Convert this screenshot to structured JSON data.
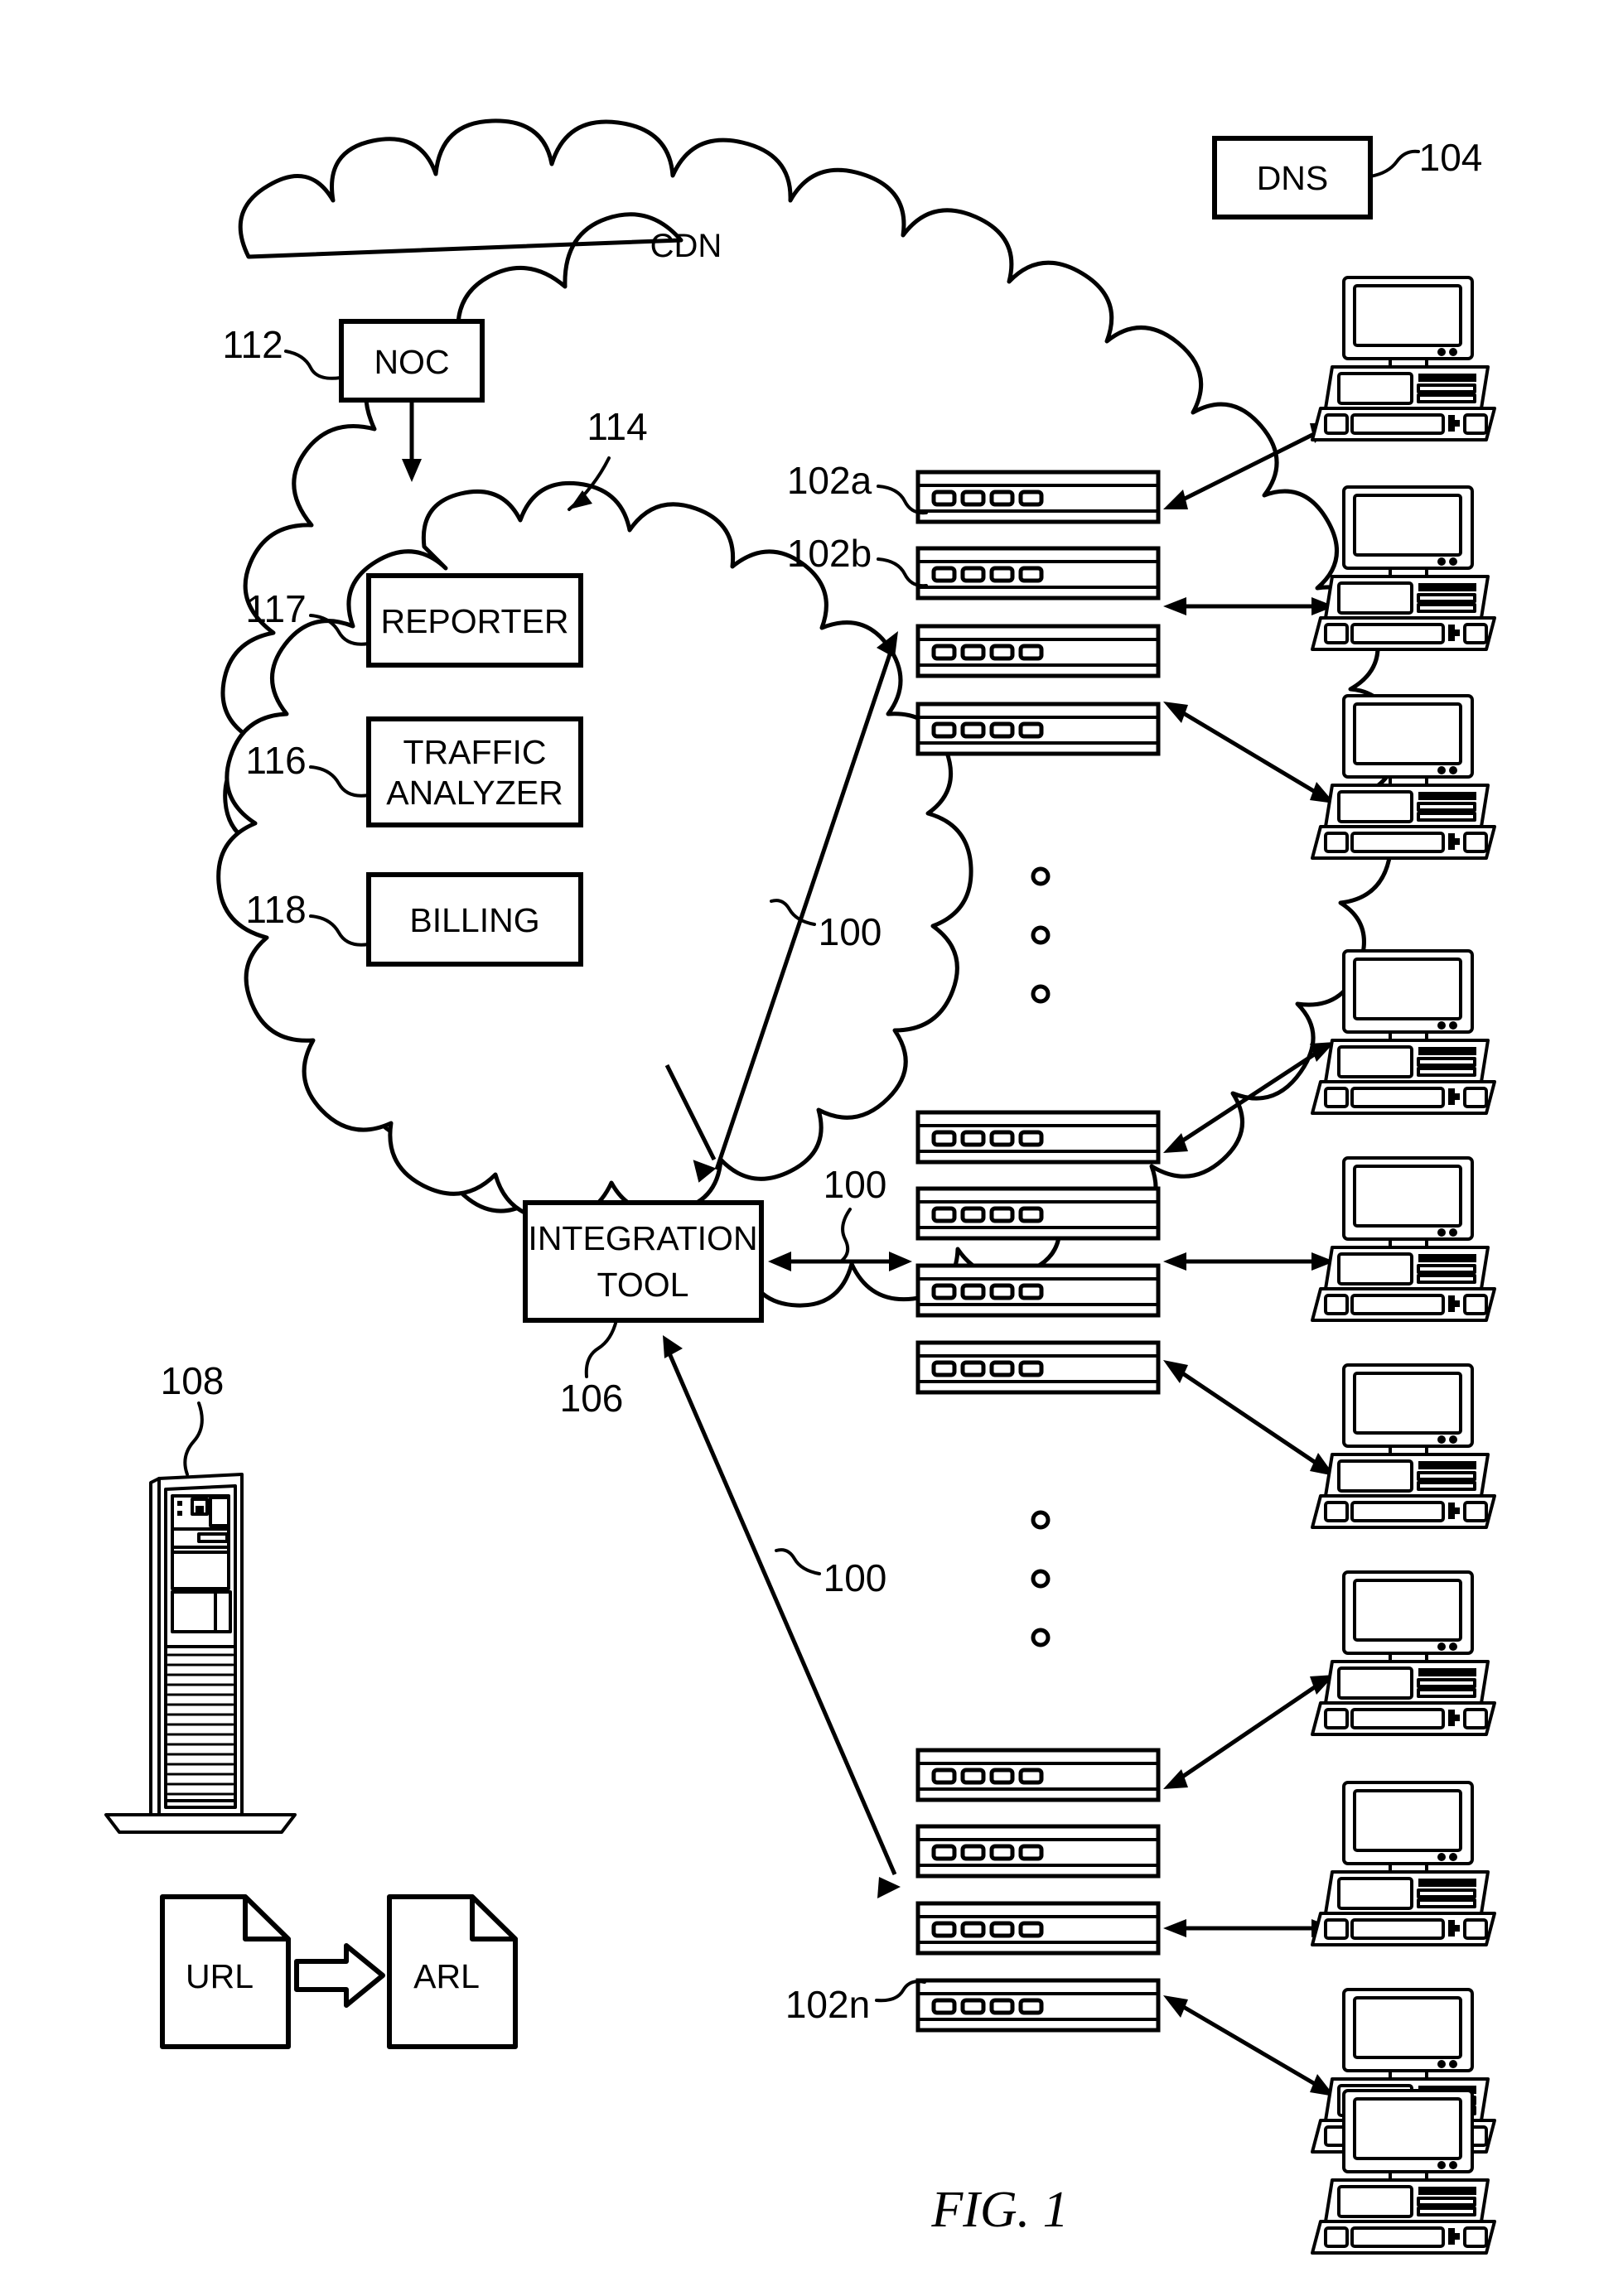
{
  "figure": {
    "caption": "FIG. 1",
    "cdn_label": "CDN"
  },
  "boxes": {
    "dns": {
      "label": "DNS",
      "ref": "104"
    },
    "noc": {
      "label": "NOC",
      "ref": "112"
    },
    "reporter": {
      "label": "REPORTER",
      "ref": "117"
    },
    "traffic_analyzer": {
      "label_line1": "TRAFFIC",
      "label_line2": "ANALYZER",
      "ref": "116"
    },
    "billing": {
      "label": "BILLING",
      "ref": "118"
    },
    "integration_tool": {
      "label_line1": "INTEGRATION",
      "label_line2": "TOOL",
      "ref": "106"
    },
    "inner_cloud": {
      "ref": "114"
    },
    "origin_server": {
      "ref": "108"
    }
  },
  "documents": {
    "url": {
      "label": "URL"
    },
    "arl": {
      "label": "ARL"
    }
  },
  "refs": {
    "edge_server_first": "102a",
    "edge_server_second": "102b",
    "edge_server_last": "102n",
    "network_top": "100",
    "network_middle": "100",
    "network_bottom": "100"
  },
  "counts": {
    "server_racks": 12,
    "client_computers": 10,
    "vertical_ellipsis_groups": 2
  },
  "colors": {
    "ink": "#000000",
    "paper": "#ffffff"
  }
}
